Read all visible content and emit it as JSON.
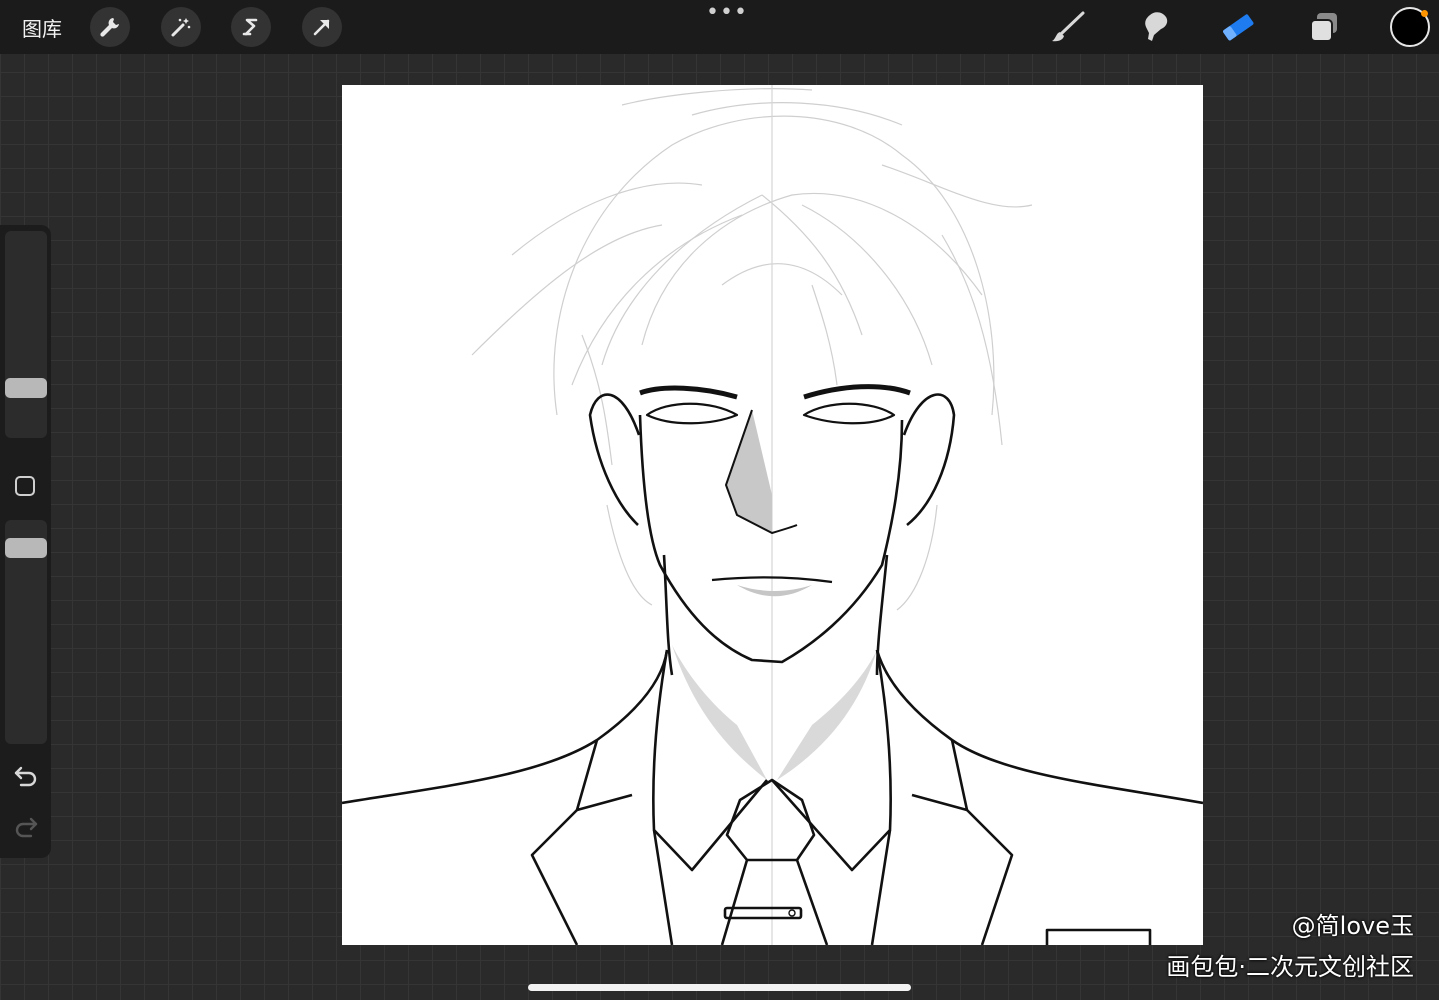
{
  "topbar": {
    "gallery_label": "图库",
    "left_tools": [
      {
        "icon": "wrench-icon",
        "name": "actions"
      },
      {
        "icon": "magic-wand-icon",
        "name": "adjustments"
      },
      {
        "icon": "selection-s-icon",
        "name": "selection"
      },
      {
        "icon": "transform-arrow-icon",
        "name": "transform"
      }
    ],
    "more_label": "•••",
    "right_tools": [
      {
        "icon": "brush-icon",
        "name": "brush",
        "active": false
      },
      {
        "icon": "smudge-icon",
        "name": "smudge",
        "active": false
      },
      {
        "icon": "eraser-icon",
        "name": "eraser",
        "active": true
      },
      {
        "icon": "layers-icon",
        "name": "layers",
        "active": false
      }
    ],
    "active_color": "#000000",
    "accent_color": "#1e7cf0",
    "notification_color": "#ff9500"
  },
  "sidebar": {
    "brush_size_level": 0.27,
    "opacity_level": 0.93,
    "icons": [
      "modifier-square-icon",
      "undo-icon",
      "redo-icon"
    ]
  },
  "canvas": {
    "background": "#ffffff",
    "subject": "line-art-portrait-man-in-suit"
  },
  "watermark": {
    "author": "@简love玉",
    "site": "画包包·二次元文创社区"
  }
}
